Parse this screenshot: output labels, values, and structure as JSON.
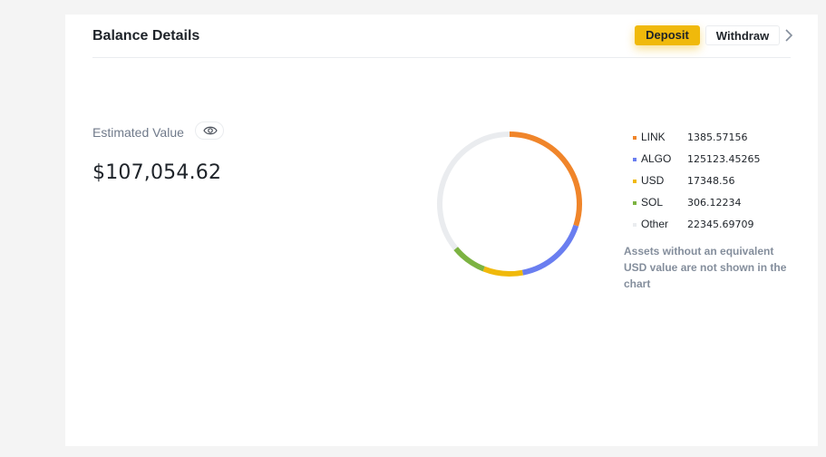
{
  "header": {
    "title": "Balance Details",
    "deposit_label": "Deposit",
    "withdraw_label": "Withdraw"
  },
  "estimated": {
    "label": "Estimated Value",
    "value": "$107,054.62"
  },
  "legend": [
    {
      "name": "LINK",
      "value": "1385.57156",
      "color": "#f0852a"
    },
    {
      "name": "ALGO",
      "value": "125123.45265",
      "color": "#6a7ef0"
    },
    {
      "name": "USD",
      "value": "17348.56",
      "color": "#f0b90b"
    },
    {
      "name": "SOL",
      "value": "306.12234",
      "color": "#7cb342"
    },
    {
      "name": "Other",
      "value": "22345.69709",
      "color": "#eaecef"
    }
  ],
  "note": "Assets without an equivalent USD value are not shown in the chart",
  "chart_data": {
    "type": "pie",
    "style": "donut",
    "categories": [
      "LINK",
      "ALGO",
      "USD",
      "SOL",
      "Other"
    ],
    "values": [
      30,
      17,
      9,
      8,
      36
    ],
    "colors": [
      "#f0852a",
      "#6a7ef0",
      "#f0b90b",
      "#7cb342",
      "#eaecef"
    ]
  }
}
